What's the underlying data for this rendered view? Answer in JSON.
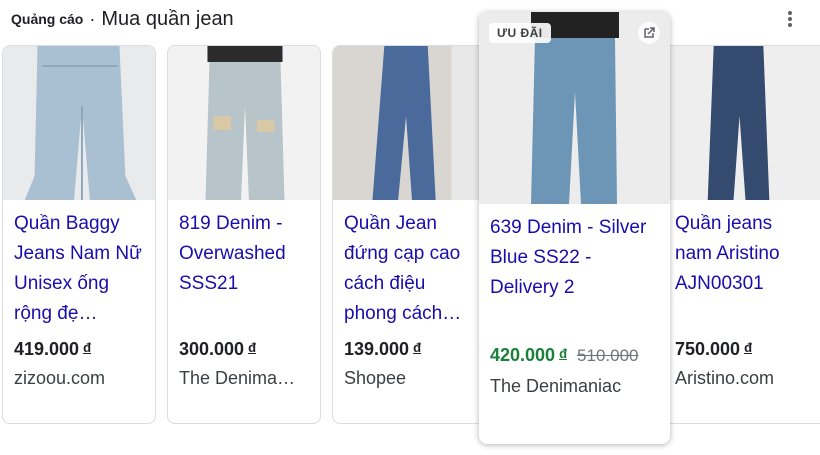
{
  "header": {
    "ad_label": "Quảng cáo",
    "separator": "·",
    "title": "Mua quần jean"
  },
  "products": [
    {
      "name": "Quần Baggy Jeans Nam Nữ Unisex ống rộng đẹ…",
      "price": "419.000",
      "currency": "đ",
      "store": "zizoou.com"
    },
    {
      "name": "819 Denim - Overwashed SSS21",
      "price": "300.000",
      "currency": "đ",
      "store": "The Denima…"
    },
    {
      "name": "Quần Jean đứng cạp cao cách điệu phong cách…",
      "price": "139.000",
      "currency": "đ",
      "store": "Shopee"
    },
    {
      "name": "639 Denim - Silver Blue SS22 - Delivery 2",
      "price": "420.000",
      "currency": "đ",
      "old_price": "510.000",
      "store": "The Denimaniac",
      "badge": "ƯU ĐÃI"
    },
    {
      "name": "Quần jeans nam Aristino AJN00301",
      "price": "750.000",
      "currency": "đ",
      "store": "Aristino.com"
    }
  ],
  "colors": {
    "link": "#1a0dab",
    "sale_price": "#188038",
    "text": "#202124",
    "muted": "#70757a"
  }
}
